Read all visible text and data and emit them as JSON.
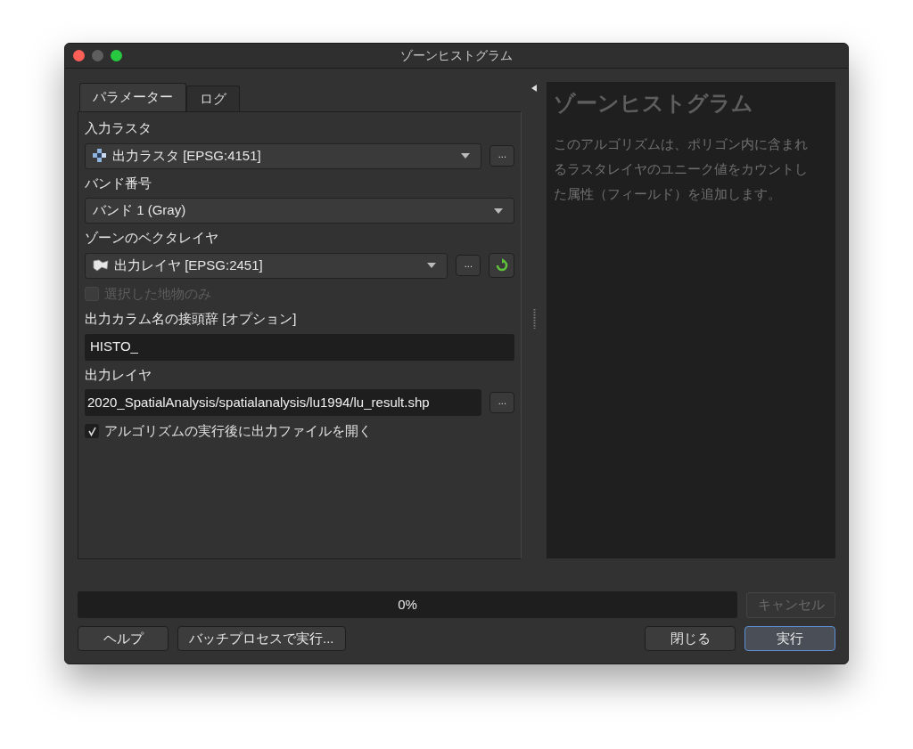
{
  "window": {
    "title": "ゾーンヒストグラム"
  },
  "tabs": [
    {
      "label": "パラメーター",
      "selected": true
    },
    {
      "label": "ログ",
      "selected": false
    }
  ],
  "params": [
    {
      "kind": "label",
      "text": "入力ラスタ"
    },
    {
      "kind": "raster_combo",
      "value": "出力ラスタ [EPSG:4151]",
      "browse": "...",
      "refresh": false
    },
    {
      "kind": "label",
      "text": "バンド番号"
    },
    {
      "kind": "combo",
      "value": "バンド 1 (Gray)",
      "refresh": false
    },
    {
      "kind": "label",
      "text": "ゾーンのベクタレイヤ"
    },
    {
      "kind": "vector_combo",
      "value": "出力レイヤ [EPSG:2451]",
      "browse": "...",
      "refresh": true
    },
    {
      "kind": "checkbox",
      "label": "選択した地物のみ",
      "checked": false,
      "disabled": true
    },
    {
      "kind": "label",
      "text": "出力カラム名の接頭辞 [オプション]"
    },
    {
      "kind": "text",
      "value": "HISTO_"
    },
    {
      "kind": "label",
      "text": "出力レイヤ"
    },
    {
      "kind": "file",
      "value": "2020_SpatialAnalysis/spatialanalysis/lu1994/lu_result.shp",
      "browse": "..."
    },
    {
      "kind": "checkbox",
      "label": "アルゴリズムの実行後に出力ファイルを開く",
      "checked": true,
      "disabled": false
    }
  ],
  "help": {
    "title": "ゾーンヒストグラム",
    "text": "このアルゴリズムは、ポリゴン内に含まれるラスタレイヤのユニーク値をカウントした属性（フィールド）を追加します。"
  },
  "progress": {
    "level": 0,
    "text": "0%"
  },
  "cancel": {
    "label": "キャンセル",
    "disabled": true
  },
  "left_buttons": [
    {
      "label": "ヘルプ",
      "default": false
    },
    {
      "label": "バッチプロセスで実行...",
      "default": false
    }
  ],
  "right_buttons": [
    {
      "label": "閉じる",
      "default": false
    },
    {
      "label": "実行",
      "default": true
    }
  ]
}
